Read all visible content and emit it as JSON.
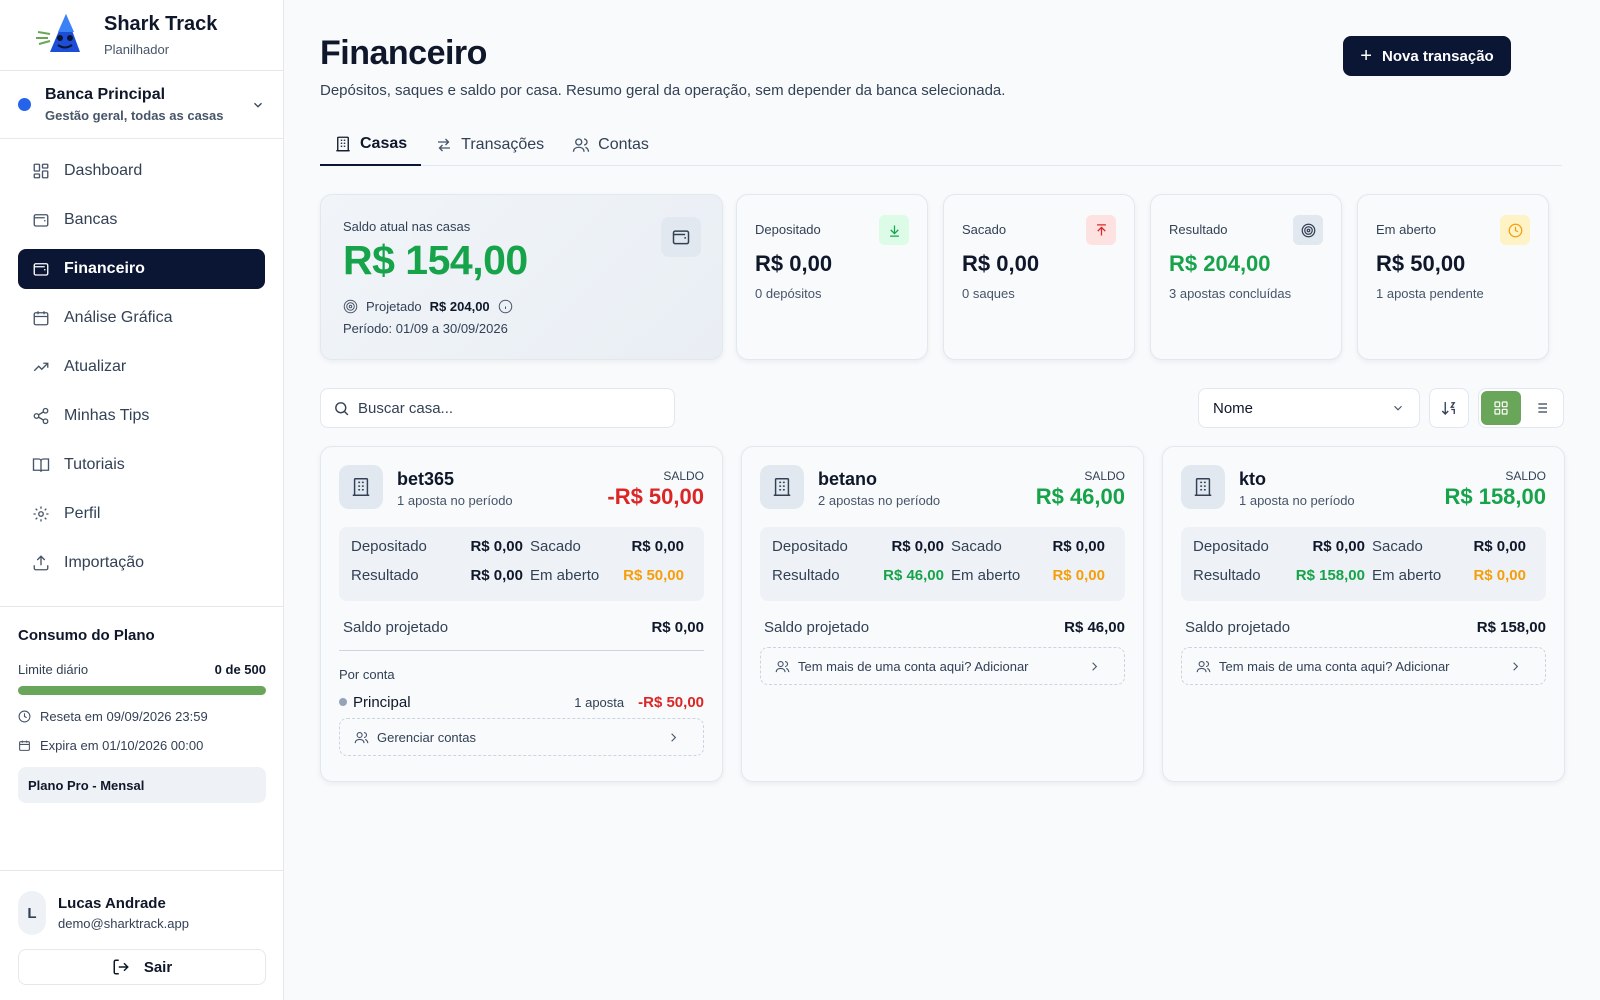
{
  "brand": {
    "title": "Shark Track",
    "subtitle": "Planilhador"
  },
  "bank": {
    "name": "Banca Principal",
    "subtitle": "Gestão geral, todas as casas",
    "dot_color": "#2563eb"
  },
  "nav": {
    "items": [
      {
        "label": "Dashboard",
        "icon": "grid-icon"
      },
      {
        "label": "Bancas",
        "icon": "wallet-icon"
      },
      {
        "label": "Financeiro",
        "icon": "wallet-icon",
        "active": true
      },
      {
        "label": "Análise Gráfica",
        "icon": "calendar-icon"
      },
      {
        "label": "Atualizar",
        "icon": "trending-up-icon"
      },
      {
        "label": "Minhas Tips",
        "icon": "share-icon"
      },
      {
        "label": "Tutoriais",
        "icon": "book-icon"
      },
      {
        "label": "Perfil",
        "icon": "gear-icon"
      },
      {
        "label": "Importação",
        "icon": "upload-icon"
      }
    ]
  },
  "plan": {
    "title": "Consumo do Plano",
    "limit_label": "Limite diário",
    "limit_value": "0 de 500",
    "usage_fraction": 1.0,
    "bar_color": "#6aa65a",
    "reset_text": "Reseta em 09/09/2026 23:59",
    "expire_text": "Expira em 01/10/2026 00:00",
    "badge": "Plano Pro - Mensal"
  },
  "user": {
    "initial": "L",
    "name": "Lucas Andrade",
    "email": "demo@sharktrack.app",
    "logout_label": "Sair"
  },
  "header": {
    "title": "Financeiro",
    "description": "Depósitos, saques e saldo por casa. Resumo geral da operação, sem depender da banca selecionada.",
    "new_button": "Nova transação"
  },
  "tabs": [
    {
      "label": "Casas",
      "active": true
    },
    {
      "label": "Transações"
    },
    {
      "label": "Contas"
    }
  ],
  "balance": {
    "label": "Saldo atual nas casas",
    "value": "R$ 154,00",
    "projected_label": "Projetado",
    "projected_value": "R$ 204,00",
    "period": "Período: 01/09 a 30/09/2026"
  },
  "stats": [
    {
      "label": "Depositado",
      "value": "R$ 0,00",
      "sub": "0 depósitos",
      "icon": "arrow-down-icon",
      "icon_color": "#16a34a",
      "icon_bg": "#dcfce7",
      "value_color": "#0f172a"
    },
    {
      "label": "Sacado",
      "value": "R$ 0,00",
      "sub": "0 saques",
      "icon": "arrow-up-icon",
      "icon_color": "#dc2626",
      "icon_bg": "#fee2e2",
      "value_color": "#0f172a"
    },
    {
      "label": "Resultado",
      "value": "R$ 204,00",
      "sub": "3 apostas concluídas",
      "icon": "target-icon",
      "icon_color": "#334155",
      "icon_bg": "#e2e8f0",
      "value_color": "#16a34a"
    },
    {
      "label": "Em aberto",
      "value": "R$ 50,00",
      "sub": "1 aposta pendente",
      "icon": "clock-icon",
      "icon_color": "#f59e0b",
      "icon_bg": "#fef3c7",
      "value_color": "#0f172a"
    }
  ],
  "toolbar": {
    "search_placeholder": "Buscar casa...",
    "sort_value": "Nome"
  },
  "houses": [
    {
      "name": "bet365",
      "sub": "1 aposta no período",
      "saldo_label": "SALDO",
      "saldo": "-R$ 50,00",
      "saldo_color": "#dc2626",
      "dep_label": "Depositado",
      "dep": "R$ 0,00",
      "sac_label": "Sacado",
      "sac": "R$ 0,00",
      "res_label": "Resultado",
      "res": "R$ 0,00",
      "res_color": "#0f172a",
      "open_label": "Em aberto",
      "open": "R$ 50,00",
      "open_color": "#f59e0b",
      "proj_label": "Saldo projetado",
      "proj": "R$ 0,00",
      "por_conta": "Por conta",
      "account_name": "Principal",
      "account_count": "1 aposta",
      "account_value": "-R$ 50,00",
      "link": "Gerenciar contas"
    },
    {
      "name": "betano",
      "sub": "2 apostas no período",
      "saldo_label": "SALDO",
      "saldo": "R$ 46,00",
      "saldo_color": "#16a34a",
      "dep_label": "Depositado",
      "dep": "R$ 0,00",
      "sac_label": "Sacado",
      "sac": "R$ 0,00",
      "res_label": "Resultado",
      "res": "R$ 46,00",
      "res_color": "#16a34a",
      "open_label": "Em aberto",
      "open": "R$ 0,00",
      "open_color": "#f59e0b",
      "proj_label": "Saldo projetado",
      "proj": "R$ 46,00",
      "link": "Tem mais de uma conta aqui? Adicionar"
    },
    {
      "name": "kto",
      "sub": "1 aposta no período",
      "saldo_label": "SALDO",
      "saldo": "R$ 158,00",
      "saldo_color": "#16a34a",
      "dep_label": "Depositado",
      "dep": "R$ 0,00",
      "sac_label": "Sacado",
      "sac": "R$ 0,00",
      "res_label": "Resultado",
      "res": "R$ 158,00",
      "res_color": "#16a34a",
      "open_label": "Em aberto",
      "open": "R$ 0,00",
      "open_color": "#f59e0b",
      "proj_label": "Saldo projetado",
      "proj": "R$ 158,00",
      "link": "Tem mais de uma conta aqui? Adicionar"
    }
  ]
}
